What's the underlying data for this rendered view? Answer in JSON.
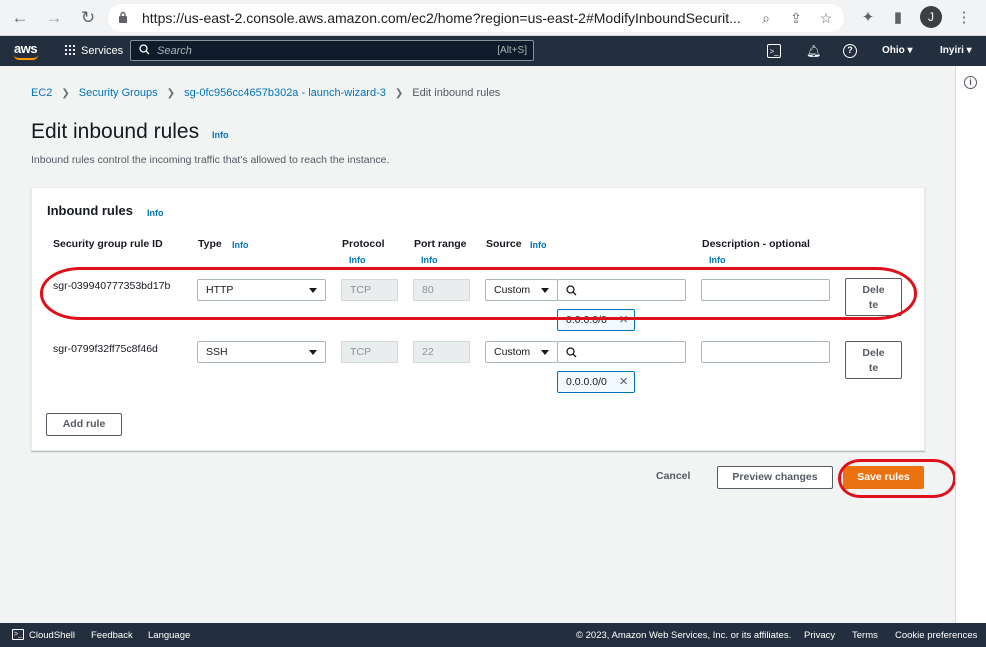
{
  "browser": {
    "url": "https://us-east-2.console.aws.amazon.com/ec2/home?region=us-east-2#ModifyInboundSecurit...",
    "profile_initial": "J"
  },
  "header": {
    "logo": "aws",
    "services_label": "Services",
    "search_placeholder": "Search",
    "search_shortcut": "[Alt+S]",
    "region": "Ohio ▾",
    "user": "Inyiri ▾"
  },
  "breadcrumb": {
    "items": [
      "EC2",
      "Security Groups",
      "sg-0fc956cc4657b302a - launch-wizard-3"
    ],
    "current": "Edit inbound rules"
  },
  "page": {
    "title": "Edit inbound rules",
    "title_info": "Info",
    "description": "Inbound rules control the incoming traffic that's allowed to reach the instance."
  },
  "panel": {
    "heading": "Inbound rules",
    "heading_info": "Info",
    "columns": {
      "rule_id": "Security group rule ID",
      "type": "Type",
      "type_info": "Info",
      "protocol": "Protocol",
      "protocol_info": "Info",
      "port_range": "Port range",
      "port_range_info": "Info",
      "source": "Source",
      "source_info": "Info",
      "description": "Description - optional",
      "description_info": "Info"
    },
    "rules": [
      {
        "id": "sgr-039940777353bd17b",
        "type": "HTTP",
        "protocol": "TCP",
        "port": "80",
        "source": "Custom",
        "cidr": "0.0.0.0/0",
        "delete_line1": "Dele",
        "delete_line2": "te"
      },
      {
        "id": "sgr-0799f32ff75c8f46d",
        "type": "SSH",
        "protocol": "TCP",
        "port": "22",
        "source": "Custom",
        "cidr": "0.0.0.0/0",
        "delete_line1": "Dele",
        "delete_line2": "te"
      }
    ],
    "add_rule": "Add rule"
  },
  "actions": {
    "cancel": "Cancel",
    "preview": "Preview changes",
    "save": "Save rules"
  },
  "footer": {
    "cloudshell": "CloudShell",
    "feedback": "Feedback",
    "language": "Language",
    "copyright": "© 2023, Amazon Web Services, Inc. or its affiliates.",
    "privacy": "Privacy",
    "terms": "Terms",
    "cookies": "Cookie preferences"
  },
  "colors": {
    "aws_dark": "#232f3e",
    "primary_orange": "#ec7211",
    "link_blue": "#0073bb",
    "annotation_red": "#e0101a"
  }
}
